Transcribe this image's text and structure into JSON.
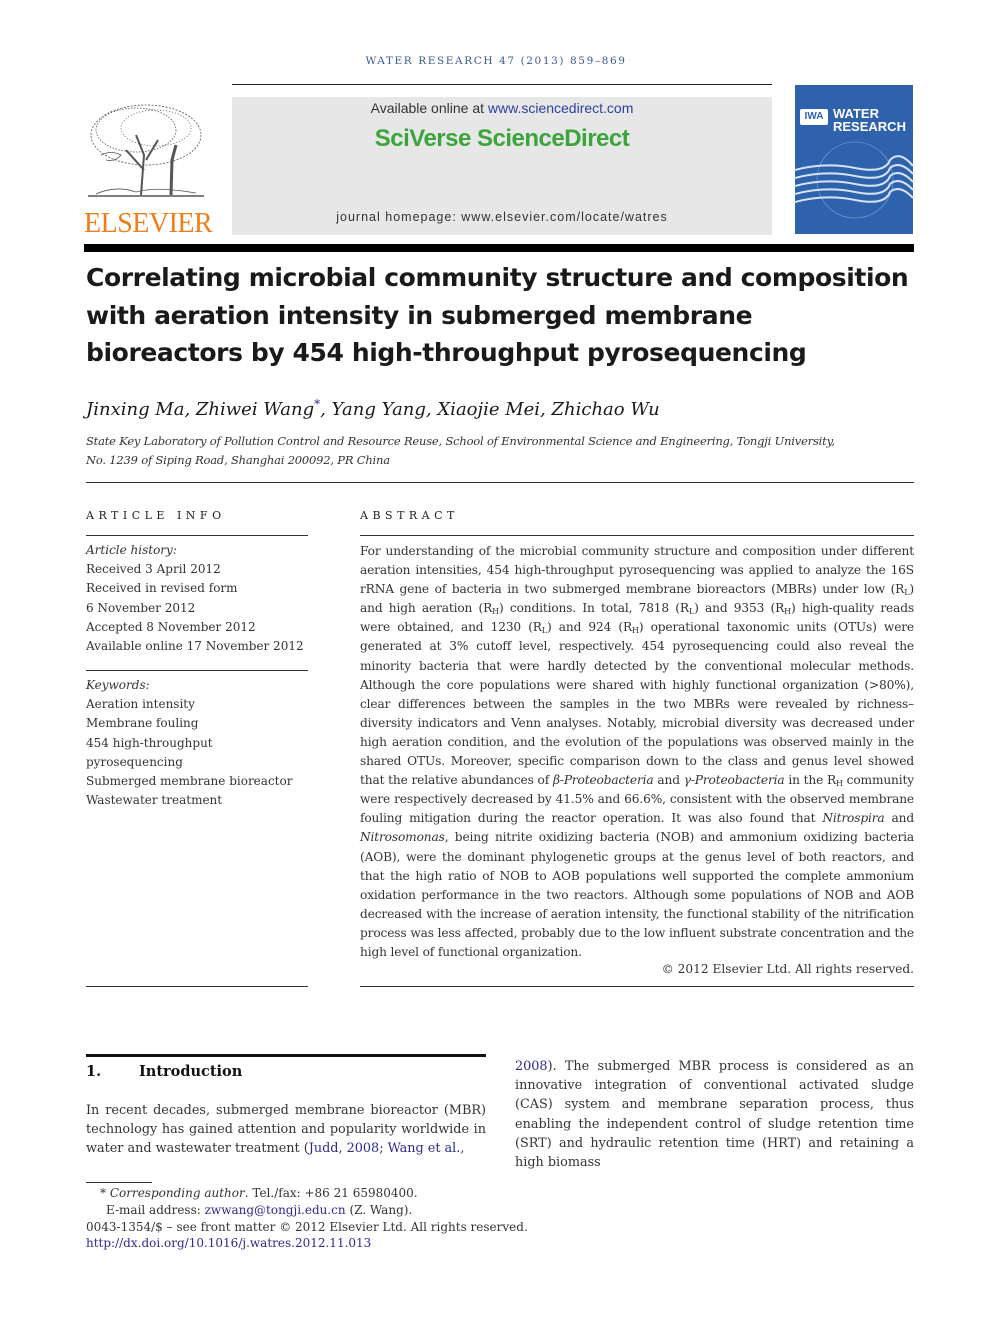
{
  "running_header": "WATER RESEARCH 47 (2013) 859–869",
  "masthead": {
    "publisher": "ELSEVIER",
    "available_online_prefix": "Available online at ",
    "available_online_link": "www.sciencedirect.com",
    "brand": "SciVerse ScienceDirect",
    "journal_homepage_prefix": "journal homepage: ",
    "journal_homepage_link": "www.elsevier.com/locate/watres",
    "cover": {
      "badge": "IWA",
      "title_line1": "WATER",
      "title_line2": "RESEARCH"
    },
    "colors": {
      "elsevier_orange": "#f07d18",
      "sciencedirect_green": "#3ba43b",
      "cover_blue": "#2e62ad",
      "link_blue": "#2b2b8c"
    }
  },
  "article": {
    "title": "Correlating microbial community structure and composition with aeration intensity in submerged membrane bioreactors by 454 high-throughput pyrosequencing",
    "authors_before": "Jinxing Ma, Zhiwei Wang",
    "author_mark": "*",
    "authors_after": ", Yang Yang, Xiaojie Mei, Zhichao Wu",
    "affiliation_line1": "State Key Laboratory of Pollution Control and Resource Reuse, School of Environmental Science and Engineering, Tongji University,",
    "affiliation_line2": "No. 1239 of Siping Road, Shanghai 200092, PR China"
  },
  "article_info": {
    "label": "ARTICLE INFO",
    "history_heading": "Article history:",
    "history": [
      "Received 3 April 2012",
      "Received in revised form",
      "6 November 2012",
      "Accepted 8 November 2012",
      "Available online 17 November 2012"
    ],
    "keywords_heading": "Keywords:",
    "keywords": [
      "Aeration intensity",
      "Membrane fouling",
      "454 high-throughput",
      "pyrosequencing",
      "Submerged membrane bioreactor",
      "Wastewater treatment"
    ]
  },
  "abstract": {
    "label": "ABSTRACT",
    "p1": "For understanding of the microbial community structure and composition under different aeration intensities, 454 high-throughput pyrosequencing was applied to analyze the 16S rRNA gene of bacteria in two submerged membrane bioreactors (MBRs) under low (R",
    "sub_L": "L",
    "sub_H": "H",
    "p2": ") and high aeration (R",
    "p3": ") conditions. In total, 7818 (R",
    "p4": ") and 9353 (R",
    "p5": ") high-quality reads were obtained, and 1230 (R",
    "p6": ") and 924 (R",
    "p7": ") operational taxonomic units (OTUs) were generated at 3% cutoff level, respectively. 454 pyrosequencing could also reveal the minority bacteria that were hardly detected by the conventional molecular methods. Although the core populations were shared with highly functional organization (>80%), clear differences between the samples in the two MBRs were revealed by richness–diversity indicators and Venn analyses. Notably, microbial diversity was decreased under high aeration condition, and the evolution of the populations was observed mainly in the shared OTUs. Moreover, specific comparison down to the class and genus level showed that the relative abundances of ",
    "beta": "β-Proteobacteria",
    "and1": " and ",
    "gamma": "γ-Proteobacteria",
    "p8": " in the R",
    "p9": " community were respectively decreased by 41.5% and 66.6%, consistent with the observed membrane fouling mitigation during the reactor operation. It was also found that ",
    "nitrospira": "Nitrospira",
    "and2": " and ",
    "nitrosomonas": "Nitrosomonas",
    "p10": ", being nitrite oxidizing bacteria (NOB) and ammonium oxidizing bacteria (AOB), were the dominant phylogenetic groups at the genus level of both reactors, and that the high ratio of NOB to AOB populations well supported the complete ammonium oxidation performance in the two reactors. Although some populations of NOB and AOB decreased with the increase of aeration intensity, the functional stability of the nitrification process was less affected, probably due to the low influent substrate concentration and the high level of functional organization.",
    "copyright": "© 2012 Elsevier Ltd. All rights reserved."
  },
  "introduction": {
    "number": "1.",
    "heading": "Introduction",
    "col1_text": "In recent decades, submerged membrane bioreactor (MBR) technology has gained attention and popularity worldwide in water and wastewater treatment (",
    "ref1": "Judd, 2008",
    "sep": "; ",
    "ref2a": "Wang et al.,",
    "ref2b": "2008",
    "col2_text": "). The submerged MBR process is considered as an innovative integration of conventional activated sludge (CAS) system and membrane separation process, thus enabling the independent control of sludge retention time (SRT) and hydraulic retention time (HRT) and retaining a high biomass"
  },
  "footnotes": {
    "mark": "*",
    "corresponding_label": "Corresponding author",
    "corresponding_rest": ". Tel./fax: +86 21 65980400.",
    "email_label": "E-mail address: ",
    "email": "zwwang@tongji.edu.cn",
    "email_suffix": " (Z. Wang).",
    "front_matter": "0043-1354/$ – see front matter © 2012 Elsevier Ltd. All rights reserved.",
    "doi": "http://dx.doi.org/10.1016/j.watres.2012.11.013"
  }
}
